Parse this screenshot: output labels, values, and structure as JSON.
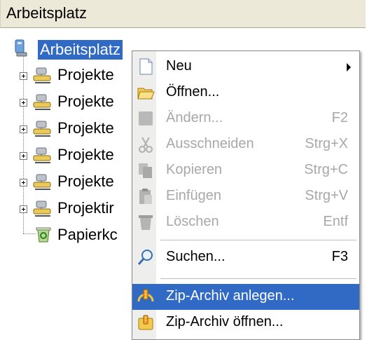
{
  "window": {
    "title": "Arbeitsplatz"
  },
  "tree": {
    "root": {
      "label": "Arbeitsplatz"
    },
    "items": [
      {
        "label": "Projekte"
      },
      {
        "label": "Projekte"
      },
      {
        "label": "Projekte"
      },
      {
        "label": "Projekte"
      },
      {
        "label": "Projekte"
      },
      {
        "label": "Projektir"
      },
      {
        "label": "Papierkc"
      }
    ]
  },
  "context_menu": {
    "items": [
      {
        "label": "Neu",
        "shortcut": "",
        "icon": "new-document-icon"
      },
      {
        "label": "Öffnen...",
        "shortcut": "",
        "icon": "open-folder-icon"
      },
      {
        "label": "Ändern...",
        "shortcut": "F2",
        "icon": "edit-icon"
      },
      {
        "label": "Ausschneiden",
        "shortcut": "Strg+X",
        "icon": "scissors-icon"
      },
      {
        "label": "Kopieren",
        "shortcut": "Strg+C",
        "icon": "copy-icon"
      },
      {
        "label": "Einfügen",
        "shortcut": "Strg+V",
        "icon": "paste-icon"
      },
      {
        "label": "Löschen",
        "shortcut": "Entf",
        "icon": "delete-icon"
      },
      {
        "label": "Suchen...",
        "shortcut": "F3",
        "icon": "search-icon"
      },
      {
        "label": "Zip-Archiv anlegen...",
        "shortcut": "",
        "icon": "zip-create-icon"
      },
      {
        "label": "Zip-Archiv öffnen...",
        "shortcut": "",
        "icon": "zip-open-icon"
      }
    ]
  },
  "colors": {
    "selection": "#316ac5",
    "disabled_text": "#a8a8a8",
    "menu_gutter": "#eeeeec",
    "title_bar": "#ece9d8"
  }
}
